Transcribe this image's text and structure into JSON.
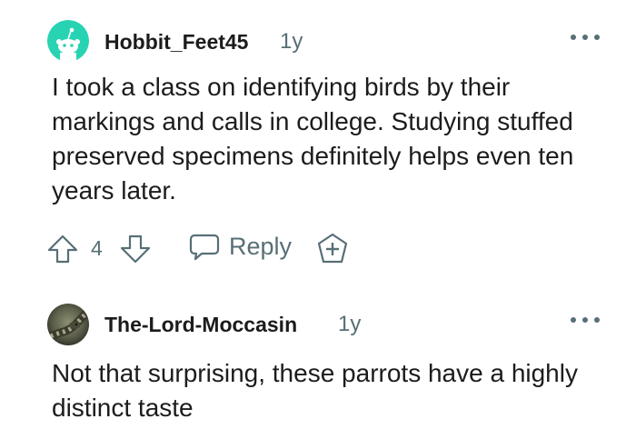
{
  "comments": [
    {
      "username": "Hobbit_Feet45",
      "age": "1y",
      "text": "I took a class on identifying birds by their markings and calls in college. Studying stuffed preserved specimens definitely helps even ten years later.",
      "score": "4",
      "reply_label": "Reply",
      "avatar_color": "#28d3b3"
    },
    {
      "username": "The-Lord-Moccasin",
      "age": "1y",
      "text": "Not that surprising, these parrots have a highly distinct taste"
    }
  ],
  "colors": {
    "text": "#1c1c1c",
    "meta": "#576f76",
    "avatar_teal": "#28d3b3"
  },
  "icons": [
    "more-icon",
    "upvote-icon",
    "downvote-icon",
    "comment-bubble-icon",
    "award-plus-icon",
    "snoo-avatar-icon",
    "snake-avatar-icon"
  ]
}
